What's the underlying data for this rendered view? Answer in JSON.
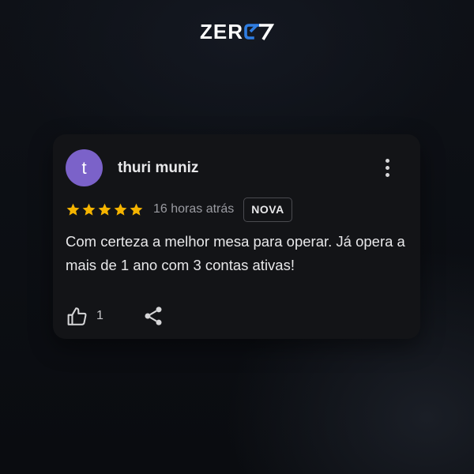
{
  "brand": {
    "logo_text": "ZER",
    "logo_suffix": "07",
    "accent_color": "#2f7de1"
  },
  "review": {
    "avatar_letter": "t",
    "avatar_color": "#7b62c9",
    "author": "thuri muniz",
    "rating": 5,
    "rating_max": 5,
    "time_ago": "16 horas atrás",
    "badge": "NOVA",
    "text": "Com certeza a melhor mesa para operar. Já opera a mais de 1 ano com 3 contas ativas!",
    "likes": "1",
    "star_color": "#f5b400"
  },
  "icons": {
    "more": "more-vert-icon",
    "star": "star-icon",
    "like": "thumb-up-icon",
    "share": "share-icon"
  }
}
